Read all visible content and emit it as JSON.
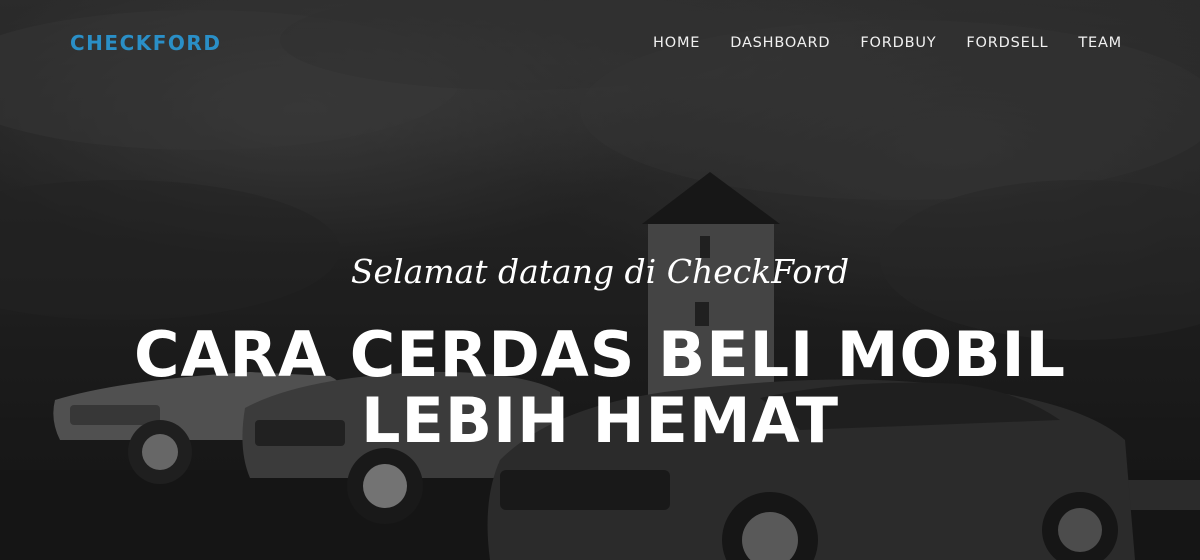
{
  "navbar": {
    "brand": "CHECKFORD",
    "items": [
      {
        "label": "HOME"
      },
      {
        "label": "DASHBOARD"
      },
      {
        "label": "FORDBUY"
      },
      {
        "label": "FORDSELL"
      },
      {
        "label": "TEAM"
      }
    ]
  },
  "hero": {
    "subheading": "Selamat datang di CheckFord",
    "heading_line1": "CARA CERDAS BELI MOBIL",
    "heading_line2": "LEBIH HEMAT"
  },
  "colors": {
    "brand": "#2a8fc7",
    "nav_text": "#f1f1f1",
    "hero_text": "#ffffff"
  }
}
